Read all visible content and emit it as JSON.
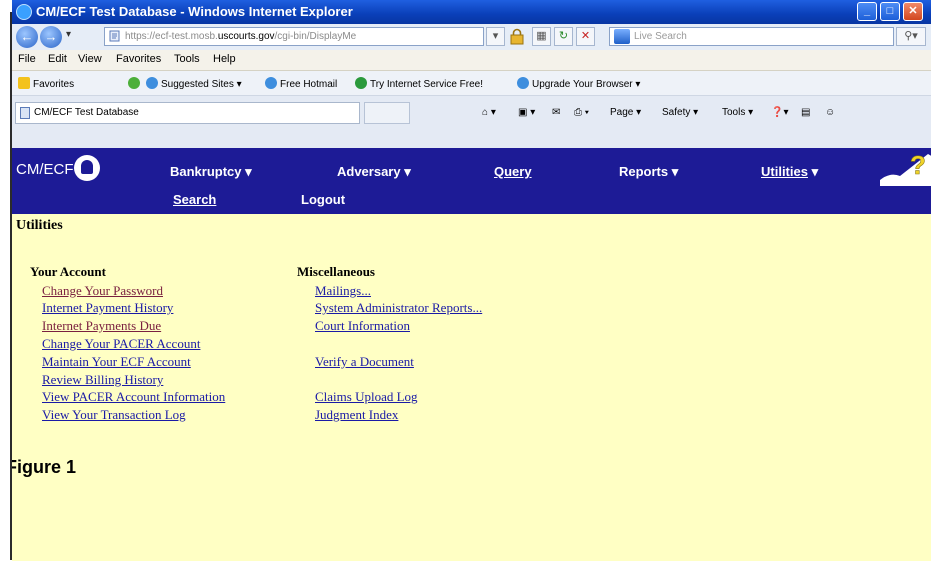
{
  "window": {
    "title": "CM/ECF Test Database - Windows Internet Explorer"
  },
  "address": {
    "url_prefix": "https://ecf-test.mosb.",
    "url_domain": "uscourts.gov",
    "url_suffix": "/cgi-bin/DisplayMe",
    "search_placeholder": "Live Search"
  },
  "menu": [
    "File",
    "Edit",
    "View",
    "Favorites",
    "Tools",
    "Help"
  ],
  "favorites": {
    "label": "Favorites",
    "items": [
      "Suggested Sites ▾",
      "Free Hotmail",
      "Try Internet Service Free!",
      "Upgrade Your Browser ▾"
    ]
  },
  "tab": {
    "label": "CM/ECF Test Database"
  },
  "commandbar": {
    "page": "Page ▾",
    "safety": "Safety ▾",
    "tools": "Tools ▾"
  },
  "ecf": {
    "logo": "CM/ECF",
    "nav": {
      "bankruptcy": "Bankruptcy",
      "adversary": "Adversary",
      "query": "Query",
      "reports": "Reports",
      "utilities": "Utilities",
      "search": "Search",
      "logout": "Logout"
    }
  },
  "page": {
    "title": "Utilities",
    "your_account": {
      "heading": "Your Account",
      "links": [
        "Change Your Password",
        "Internet Payment History",
        "Internet Payments Due",
        "Change Your PACER Account",
        "Maintain Your ECF Account",
        "Review Billing History",
        "View PACER Account Information",
        "View Your Transaction Log"
      ]
    },
    "miscellaneous": {
      "heading": "Miscellaneous",
      "links": [
        "Mailings...",
        "System Administrator Reports...",
        "Court Information",
        "Verify a Document",
        "Claims Upload Log",
        "Judgment Index"
      ]
    }
  },
  "figure_label": "Figure 1"
}
